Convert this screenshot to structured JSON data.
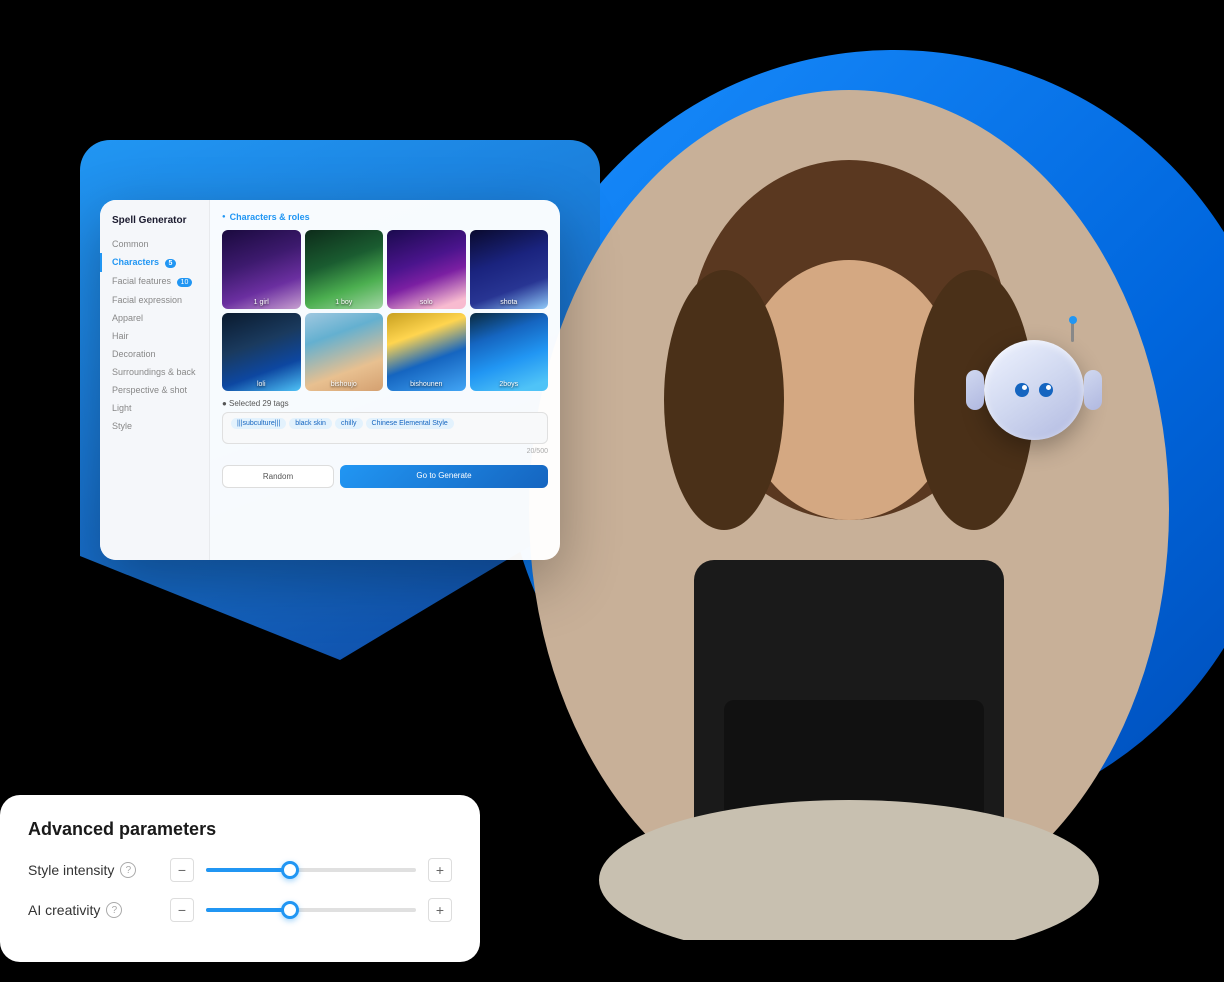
{
  "background": {
    "circle_color": "#1a8fff",
    "shape_color": "#2196f3"
  },
  "spell_card": {
    "title": "Spell Generator",
    "sidebar": {
      "items": [
        {
          "label": "Common",
          "active": false
        },
        {
          "label": "Characters",
          "active": true,
          "badge": "5"
        },
        {
          "label": "Facial features",
          "active": false,
          "badge": "10"
        },
        {
          "label": "Facial expression",
          "active": false
        },
        {
          "label": "Apparel",
          "active": false
        },
        {
          "label": "Hair",
          "active": false
        },
        {
          "label": "Decoration",
          "active": false
        },
        {
          "label": "Surroundings & back",
          "active": false
        },
        {
          "label": "Perspective & shot",
          "active": false
        },
        {
          "label": "Light",
          "active": false
        },
        {
          "label": "Style",
          "active": false
        }
      ]
    },
    "section_title": "Characters & roles",
    "images": [
      {
        "label": "1 girl",
        "class": "img-1"
      },
      {
        "label": "1 boy",
        "class": "img-2"
      },
      {
        "label": "solo",
        "class": "img-3"
      },
      {
        "label": "shota",
        "class": "img-4"
      },
      {
        "label": "loli",
        "class": "img-5"
      },
      {
        "label": "bishoujo",
        "class": "img-6"
      },
      {
        "label": "bishounen",
        "class": "img-7"
      },
      {
        "label": "2boys",
        "class": "img-8"
      }
    ],
    "selected_label": "● Selected 29 tags",
    "tags": [
      "|||subculture|||",
      "black skin",
      "chilly",
      "Chinese Elemental Style"
    ],
    "char_count": "20/500",
    "btn_random": "Random",
    "btn_generate": "Go to Generate"
  },
  "advanced_card": {
    "title": "Advanced parameters",
    "params": [
      {
        "label": "Style intensity",
        "has_help": true,
        "value": 40,
        "max": 100
      },
      {
        "label": "AI creativity",
        "has_help": true,
        "value": 40,
        "max": 100
      }
    ],
    "minus_label": "−",
    "plus_label": "+"
  },
  "robot": {
    "alt": "AI robot mascot"
  }
}
